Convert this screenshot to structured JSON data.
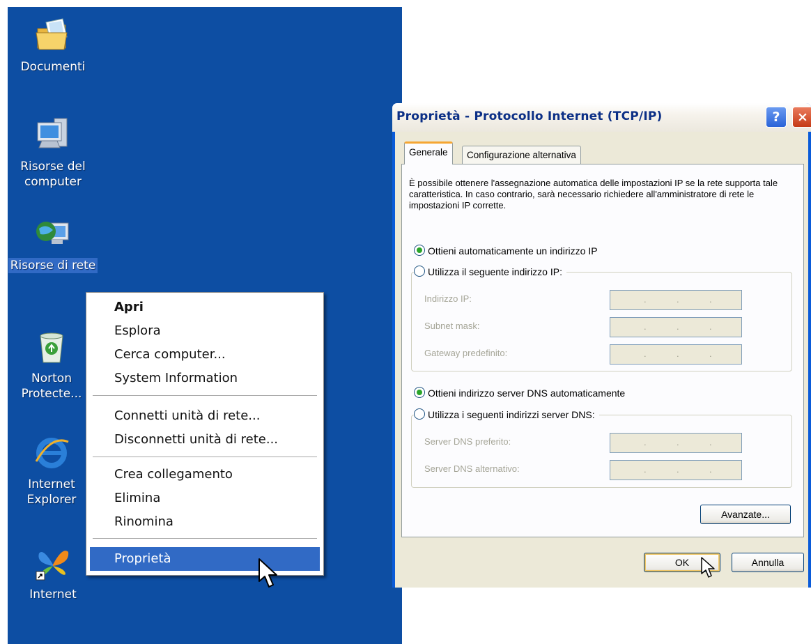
{
  "desktop": {
    "icons": [
      {
        "label": "Documenti",
        "icon": "my-documents-folder-icon"
      },
      {
        "label": "Risorse del computer",
        "icon": "my-computer-icon"
      },
      {
        "label": "Risorse di rete",
        "icon": "network-places-icon"
      },
      {
        "label": "Norton Protecte...",
        "icon": "recycle-bin-icon"
      },
      {
        "label": "Internet Explorer",
        "icon": "internet-explorer-icon"
      },
      {
        "label": "Internet",
        "icon": "msn-butterfly-shortcut-icon"
      }
    ]
  },
  "context_menu": {
    "items": [
      {
        "label": "Apri",
        "bold": true
      },
      {
        "label": "Esplora"
      },
      {
        "label": "Cerca computer..."
      },
      {
        "label": "System Information"
      },
      {
        "label": "Connetti unità di rete..."
      },
      {
        "label": "Disconnetti unità di rete..."
      },
      {
        "label": "Crea collegamento"
      },
      {
        "label": "Elimina"
      },
      {
        "label": "Rinomina"
      },
      {
        "label": "Proprietà",
        "highlighted": true
      }
    ]
  },
  "dialog": {
    "title": "Proprietà - Protocollo Internet (TCP/IP)",
    "help_label": "?",
    "close_label": "×",
    "tabs": [
      "Generale",
      "Configurazione alternativa"
    ],
    "description": "È possibile ottenere l'assegnazione automatica delle impostazioni IP se la rete supporta tale caratteristica. In caso contrario, sarà necessario richiedere all'amministratore di rete le impostazioni IP corrette.",
    "ip_auto_label": "Ottieni automaticamente un indirizzo IP",
    "ip_manual_label": "Utilizza il seguente indirizzo IP:",
    "ip_fields": [
      {
        "label": "Indirizzo IP:"
      },
      {
        "label": "Subnet mask:"
      },
      {
        "label": "Gateway predefinito:"
      }
    ],
    "dns_auto_label": "Ottieni indirizzo server DNS automaticamente",
    "dns_manual_label": "Utilizza i seguenti indirizzi server DNS:",
    "dns_fields": [
      {
        "label": "Server DNS preferito:"
      },
      {
        "label": "Server DNS alternativo:"
      }
    ],
    "ip_dot": ".",
    "advanced_label": "Avanzate...",
    "ok_label": "OK",
    "cancel_label": "Annulla",
    "selected": {
      "ip": "auto",
      "dns": "auto"
    }
  },
  "colors": {
    "desktop_bg": "#0d4ea3",
    "menu_highlight": "#316ac5",
    "dialog_frame": "#0a5bd9",
    "dialog_face": "#ece9d8",
    "radio_dot": "#2aa52a"
  }
}
